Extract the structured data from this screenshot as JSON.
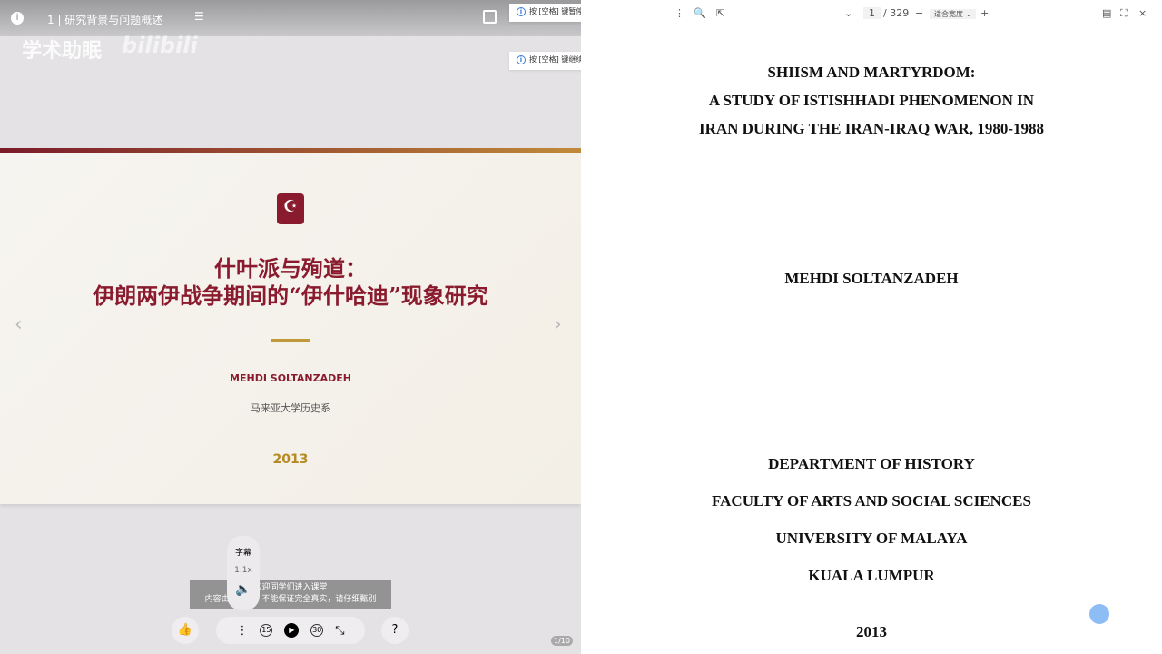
{
  "player": {
    "title": "1 | 研究背景与问题概述",
    "watermark": "学术助眠",
    "watermark_brand": "bilibili",
    "slide": {
      "title_line1": "什叶派与殉道：",
      "title_line2": "伊朗两伊战争期间的“伊什哈迪”现象研究",
      "author": "MEHDI SOLTANZADEH",
      "department": "马来亚大学历史系",
      "year": "2013"
    },
    "subtitle_line1": "欢迎同学们进入课堂",
    "subtitle_line2": "内容由AI生成，不能保证完全真实，请仔细甄别",
    "popup": {
      "captions": "字幕",
      "speed": "1.1x"
    },
    "controls": {
      "rewind": "15",
      "forward": "30"
    },
    "page_indicator": "1/10"
  },
  "toasts": [
    "按 [空格] 键暂停讲解",
    "按 [空格] 键继续讲解"
  ],
  "pdf": {
    "page": "1",
    "total": "/ 329",
    "zoom": "适合宽度",
    "lines": [
      "SHIISM AND MARTYRDOM:",
      "A STUDY OF ISTISHHADI PHENOMENON IN",
      "IRAN DURING THE IRAN-IRAQ WAR, 1980-1988",
      "MEHDI SOLTANZADEH",
      "DEPARTMENT OF HISTORY",
      "FACULTY OF ARTS AND SOCIAL SCIENCES",
      "UNIVERSITY OF MALAYA",
      "KUALA LUMPUR",
      "2013"
    ]
  }
}
